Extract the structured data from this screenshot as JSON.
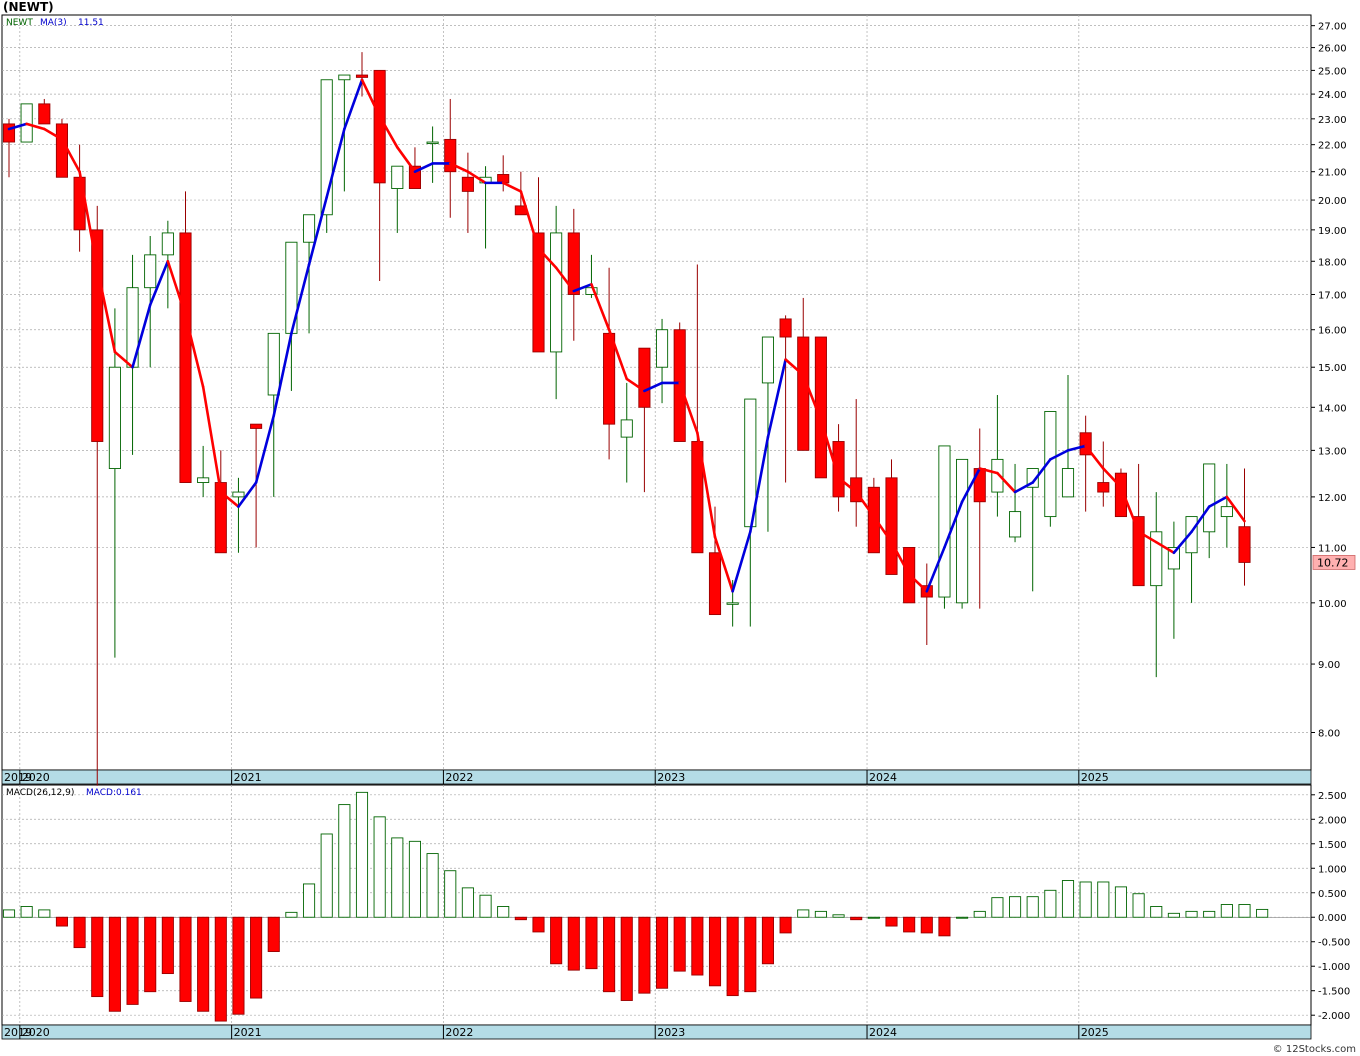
{
  "ticker_title": "(NEWT)",
  "credit": "© 12Stocks.com",
  "colors": {
    "bull": "#006400",
    "bear": "#ff0000",
    "ma_up": "#0000dd",
    "ma_down": "#ff0000",
    "grid": "#aaaaaa",
    "axis_band": "#b4dce6",
    "price_box_fill": "#ffb0b0"
  },
  "chart_data": [
    {
      "type": "candlestick",
      "scale": "log",
      "ylim": [
        7.5,
        27.5
      ],
      "ticks": [
        8,
        9,
        10,
        11,
        12,
        13,
        14,
        15,
        16,
        17,
        18,
        19,
        20,
        21,
        22,
        23,
        24,
        25,
        26,
        27
      ],
      "tick_labels": [
        "8.00",
        "9.00",
        "10.00",
        "11.00",
        "12.00",
        "13.00",
        "14.00",
        "15.00",
        "16.00",
        "17.00",
        "18.00",
        "19.00",
        "20.00",
        "21.00",
        "22.00",
        "23.00",
        "24.00",
        "25.00",
        "26.00",
        "27.00"
      ],
      "legend": {
        "symbol": "NEWT",
        "ma_label": "MA(3)",
        "ma_value": "11.51"
      },
      "last_price": "10.72",
      "year_labels": [
        "2019",
        "2020",
        "2021",
        "2022",
        "2023",
        "2024",
        "2025"
      ],
      "year_starts": [
        "2019-12",
        "2020-01",
        "2021-01",
        "2022-01",
        "2023-01",
        "2024-01",
        "2025-01"
      ],
      "months": [
        "2019-12",
        "2020-01",
        "2020-02",
        "2020-03",
        "2020-04",
        "2020-05",
        "2020-06",
        "2020-07",
        "2020-08",
        "2020-09",
        "2020-10",
        "2020-11",
        "2020-12",
        "2021-01",
        "2021-02",
        "2021-03",
        "2021-04",
        "2021-05",
        "2021-06",
        "2021-07",
        "2021-08",
        "2021-09",
        "2021-10",
        "2021-11",
        "2021-12",
        "2022-01",
        "2022-02",
        "2022-03",
        "2022-04",
        "2022-05",
        "2022-06",
        "2022-07",
        "2022-08",
        "2022-09",
        "2022-10",
        "2022-11",
        "2022-12",
        "2023-01",
        "2023-02",
        "2023-03",
        "2023-04",
        "2023-05",
        "2023-06",
        "2023-07",
        "2023-08",
        "2023-09",
        "2023-10",
        "2023-11",
        "2023-12",
        "2024-01",
        "2024-02",
        "2024-03",
        "2024-04",
        "2024-05",
        "2024-06",
        "2024-07",
        "2024-08",
        "2024-09",
        "2024-10",
        "2024-11",
        "2024-12",
        "2025-01",
        "2025-02",
        "2025-03",
        "2025-04",
        "2025-05",
        "2025-06",
        "2025-07",
        "2025-08",
        "2025-09",
        "2025-10"
      ],
      "open": [
        22.8,
        22.1,
        23.6,
        22.8,
        20.8,
        19.0,
        12.6,
        15.0,
        17.2,
        18.2,
        18.9,
        12.3,
        12.3,
        12.0,
        13.6,
        14.3,
        15.9,
        18.6,
        19.5,
        24.6,
        24.8,
        25.0,
        20.4,
        21.2,
        22.1,
        22.2,
        20.8,
        20.6,
        20.9,
        19.8,
        18.9,
        15.4,
        18.9,
        17.0,
        15.9,
        13.3,
        15.5,
        15.0,
        16.0,
        13.2,
        10.9,
        10.0,
        11.4,
        14.6,
        16.3,
        15.8,
        15.8,
        13.2,
        12.4,
        12.2,
        12.4,
        11.0,
        10.3,
        10.1,
        10.0,
        12.6,
        12.1,
        11.2,
        12.2,
        11.6,
        12.0,
        13.4,
        12.3,
        12.5,
        11.6,
        10.3,
        10.6,
        10.9,
        11.3,
        11.6,
        11.4
      ],
      "high": [
        23.0,
        23.6,
        23.8,
        23.0,
        22.0,
        19.8,
        16.6,
        18.2,
        18.8,
        19.3,
        20.3,
        13.1,
        13.0,
        12.4,
        13.5,
        15.2,
        16.3,
        18.7,
        19.7,
        24.7,
        25.8,
        25.0,
        20.4,
        21.9,
        22.7,
        23.8,
        21.7,
        21.2,
        21.6,
        21.0,
        20.8,
        19.8,
        19.7,
        18.2,
        17.8,
        14.6,
        15.5,
        16.3,
        16.2,
        17.9,
        11.8,
        10.4,
        11.5,
        15.3,
        16.4,
        16.9,
        15.8,
        13.6,
        14.2,
        12.4,
        12.8,
        11.0,
        10.7,
        10.1,
        10.9,
        13.5,
        14.3,
        12.7,
        12.6,
        13.2,
        14.8,
        13.8,
        13.2,
        12.6,
        12.7,
        12.1,
        11.5,
        11.5,
        12.2,
        12.7,
        12.6
      ],
      "low": [
        20.8,
        22.1,
        22.8,
        20.8,
        18.3,
        7.3,
        9.1,
        12.9,
        15.0,
        16.6,
        17.1,
        12.0,
        11.5,
        10.9,
        11.0,
        12.0,
        14.4,
        15.9,
        18.9,
        20.3,
        23.9,
        17.4,
        18.9,
        20.4,
        20.6,
        19.4,
        18.9,
        18.4,
        20.3,
        19.6,
        17.9,
        14.2,
        15.7,
        16.9,
        12.8,
        12.3,
        12.1,
        14.1,
        13.3,
        12.5,
        9.8,
        9.6,
        9.6,
        11.3,
        12.3,
        13.9,
        12.4,
        11.7,
        11.4,
        11.3,
        11.0,
        10.6,
        9.3,
        9.9,
        9.9,
        9.9,
        11.6,
        11.1,
        10.2,
        11.4,
        12.4,
        11.7,
        11.8,
        11.7,
        11.3,
        8.8,
        9.4,
        10.0,
        10.8,
        11.0,
        10.3
      ],
      "close": [
        22.1,
        23.6,
        22.8,
        20.8,
        19.0,
        13.2,
        15.0,
        17.2,
        18.2,
        18.9,
        12.3,
        12.4,
        10.9,
        12.1,
        13.5,
        15.9,
        18.6,
        19.5,
        24.6,
        24.8,
        24.7,
        20.6,
        21.2,
        20.4,
        22.1,
        21.0,
        20.3,
        20.8,
        20.6,
        19.5,
        15.4,
        18.9,
        17.0,
        17.2,
        13.6,
        13.7,
        14.0,
        16.0,
        13.2,
        10.9,
        9.8,
        10.0,
        14.2,
        15.8,
        15.8,
        13.0,
        12.4,
        12.0,
        11.9,
        10.9,
        10.5,
        10.0,
        10.1,
        13.1,
        12.8,
        11.9,
        12.8,
        11.7,
        12.6,
        13.9,
        12.6,
        12.9,
        12.1,
        11.6,
        10.3,
        11.3,
        11.0,
        11.6,
        12.7,
        11.8,
        10.72
      ],
      "ma": [
        22.6,
        22.8,
        22.6,
        22.2,
        21.0,
        17.8,
        15.4,
        15.0,
        16.7,
        18.0,
        16.4,
        14.5,
        12.1,
        11.8,
        12.3,
        13.8,
        15.9,
        17.9,
        20.1,
        22.6,
        24.6,
        23.1,
        21.9,
        21.0,
        21.3,
        21.3,
        21.0,
        20.6,
        20.6,
        20.3,
        18.4,
        17.8,
        17.1,
        17.3,
        16.0,
        14.7,
        14.4,
        14.6,
        14.6,
        13.4,
        11.2,
        10.2,
        11.3,
        13.3,
        15.2,
        14.8,
        13.7,
        12.4,
        12.1,
        11.6,
        11.1,
        10.5,
        10.2,
        11.0,
        11.9,
        12.6,
        12.5,
        12.1,
        12.3,
        12.8,
        13.0,
        13.1,
        12.6,
        12.2,
        11.3,
        11.1,
        10.9,
        11.3,
        11.8,
        12.0,
        11.51
      ]
    },
    {
      "type": "bar",
      "legend": {
        "label": "MACD(26,12,9)",
        "value_label": "MACD:0.161"
      },
      "ylim": [
        -2.2,
        2.7
      ],
      "ticks": [
        -2.0,
        -1.5,
        -1.0,
        -0.5,
        0.0,
        0.5,
        1.0,
        1.5,
        2.0,
        2.5
      ],
      "tick_labels": [
        "-2.000",
        "-1.500",
        "-1.000",
        "-0.500",
        "0.000",
        "0.500",
        "1.000",
        "1.500",
        "2.000",
        "2.500"
      ],
      "values": [
        0.15,
        0.22,
        0.15,
        -0.18,
        -0.62,
        -1.62,
        -1.92,
        -1.78,
        -1.52,
        -1.15,
        -1.72,
        -1.92,
        -2.12,
        -1.98,
        -1.65,
        -0.7,
        0.1,
        0.68,
        1.7,
        2.3,
        2.55,
        2.05,
        1.62,
        1.55,
        1.3,
        0.95,
        0.6,
        0.45,
        0.22,
        -0.05,
        -0.3,
        -0.95,
        -1.08,
        -1.05,
        -1.52,
        -1.7,
        -1.55,
        -1.45,
        -1.1,
        -1.18,
        -1.4,
        -1.6,
        -1.52,
        -0.95,
        -0.32,
        0.15,
        0.12,
        0.05,
        -0.05,
        0.0,
        -0.18,
        -0.3,
        -0.32,
        -0.38,
        0.0,
        0.12,
        0.4,
        0.42,
        0.42,
        0.55,
        0.75,
        0.72,
        0.72,
        0.62,
        0.48,
        0.22,
        0.08,
        0.12,
        0.12,
        0.26,
        0.26,
        0.16
      ]
    }
  ]
}
